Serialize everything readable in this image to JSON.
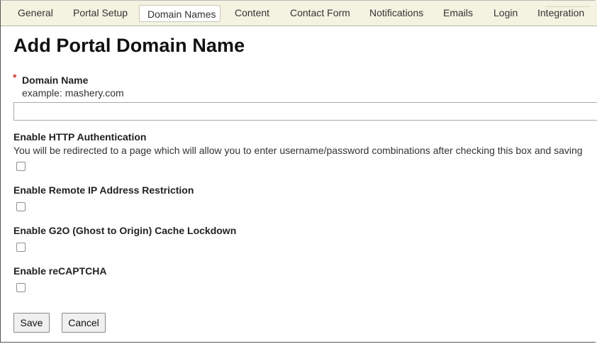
{
  "tabs": [
    {
      "label": "General"
    },
    {
      "label": "Portal Setup"
    },
    {
      "label": "Domain Names",
      "active": true
    },
    {
      "label": "Content"
    },
    {
      "label": "Contact Form"
    },
    {
      "label": "Notifications"
    },
    {
      "label": "Emails"
    },
    {
      "label": "Login"
    },
    {
      "label": "Integration"
    }
  ],
  "page": {
    "title": "Add Portal Domain Name"
  },
  "form": {
    "required_mark": "*",
    "domain_name": {
      "label": "Domain Name",
      "help": "example: mashery.com",
      "value": "",
      "placeholder": ""
    },
    "http_auth": {
      "label": "Enable HTTP Authentication",
      "help": "You will be redirected to a page which will allow you to enter username/password combinations after checking this box and saving",
      "checked": false
    },
    "remote_ip": {
      "label": "Enable Remote IP Address Restriction",
      "checked": false
    },
    "g2o": {
      "label": "Enable G2O (Ghost to Origin) Cache Lockdown",
      "checked": false
    },
    "recaptcha": {
      "label": "Enable reCAPTCHA",
      "checked": false
    },
    "save_label": "Save",
    "cancel_label": "Cancel"
  },
  "colors": {
    "tabbar_background": "#f4f3e2",
    "required_star": "#d0312d"
  }
}
